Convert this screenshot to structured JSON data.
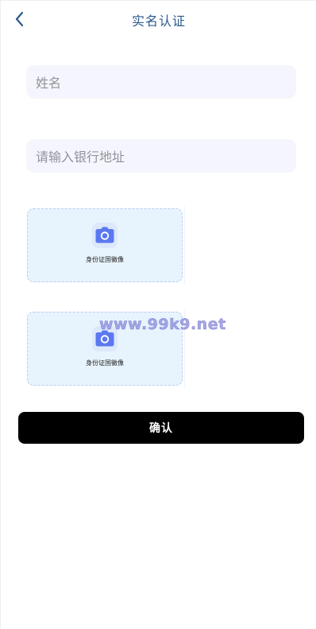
{
  "header": {
    "title": "实名认证",
    "back_icon": "chevron-left-icon"
  },
  "form": {
    "name_placeholder": "姓名",
    "name_value": "",
    "bank_placeholder": "请输入银行地址",
    "bank_value": ""
  },
  "uploads": [
    {
      "label": "身份证国徽像",
      "icon": "camera-icon"
    },
    {
      "label": "身份证国徽像",
      "icon": "camera-icon"
    }
  ],
  "watermark": "www.99k9.net",
  "confirm_label": "确认",
  "colors": {
    "title": "#2a5a8c",
    "input_bg": "#f5f6fd",
    "upload_bg": "#e8f4fd",
    "upload_border": "#b8cdf0",
    "camera": "#5b78f0",
    "button_bg": "#000000",
    "button_text": "#ffffff"
  }
}
